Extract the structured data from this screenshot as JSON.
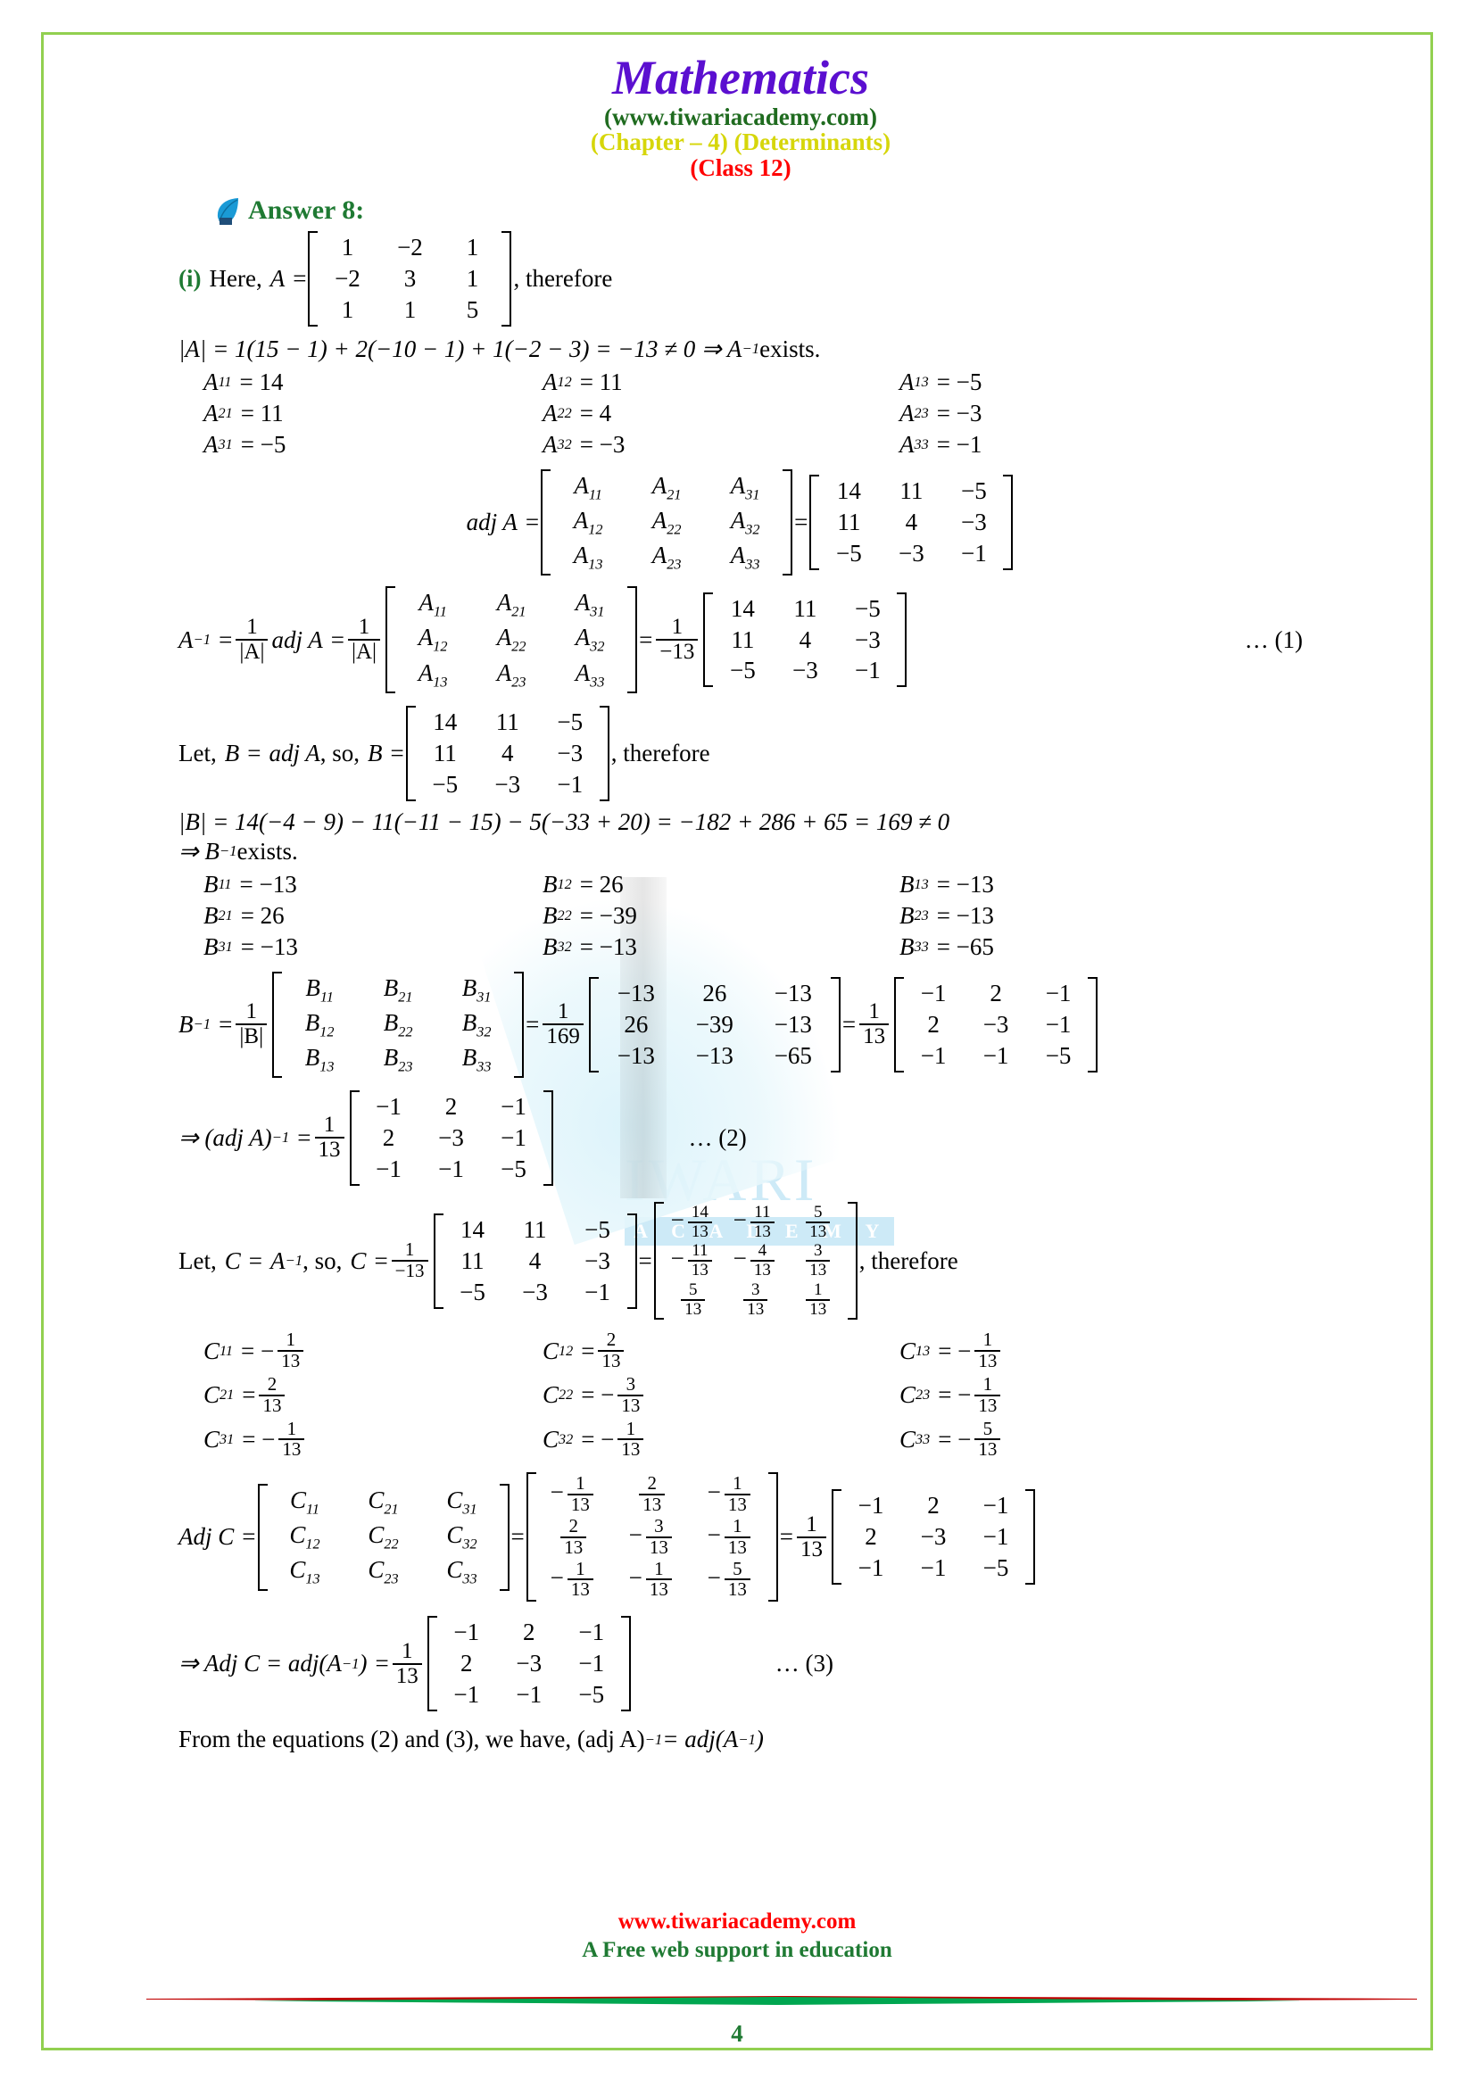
{
  "header": {
    "title": "Mathematics",
    "site": "(www.tiwariacademy.com)",
    "chapter": "(Chapter – 4) (Determinants)",
    "klass": "(Class 12)"
  },
  "answer": {
    "label": "Answer",
    "number": "8",
    "colon": ":",
    "icon": "leaf-icon"
  },
  "part_i": {
    "marker": "(i)",
    "here": "Here,",
    "A": "A",
    "eq": "=",
    "therefore": ", therefore",
    "matrix_A": [
      [
        "1",
        "−2",
        "1"
      ],
      [
        "−2",
        "3",
        "1"
      ],
      [
        "1",
        "1",
        "5"
      ]
    ]
  },
  "detA": {
    "text": "|A| = 1(15 − 1) + 2(−10 − 1) + 1(−2 − 3) = −13 ≠ 0  ⇒  A",
    "sup": "−1",
    "tail": " exists."
  },
  "A_cofactors": [
    [
      {
        "sym": "A",
        "sub": "11",
        "val": "= 14"
      },
      {
        "sym": "A",
        "sub": "12",
        "val": "= 11"
      },
      {
        "sym": "A",
        "sub": "13",
        "val": "= −5"
      }
    ],
    [
      {
        "sym": "A",
        "sub": "21",
        "val": "= 11"
      },
      {
        "sym": "A",
        "sub": "22",
        "val": "= 4"
      },
      {
        "sym": "A",
        "sub": "23",
        "val": "= −3"
      }
    ],
    [
      {
        "sym": "A",
        "sub": "31",
        "val": "= −5"
      },
      {
        "sym": "A",
        "sub": "32",
        "val": "= −3"
      },
      {
        "sym": "A",
        "sub": "33",
        "val": "= −1"
      }
    ]
  ],
  "adjA": {
    "label": "adj A",
    "eq1": "=",
    "eq2": "=",
    "sym_matrix": [
      [
        "A11",
        "A21",
        "A31"
      ],
      [
        "A12",
        "A22",
        "A32"
      ],
      [
        "A13",
        "A23",
        "A33"
      ]
    ],
    "num_matrix": [
      [
        "14",
        "11",
        "−5"
      ],
      [
        "11",
        "4",
        "−3"
      ],
      [
        "−5",
        "−3",
        "−1"
      ]
    ]
  },
  "Ainv": {
    "lhs": "A",
    "lhs_sup": "−1",
    "eq": "=",
    "frac_num": "1",
    "frac_den": "|A|",
    "adjtext": "adj A",
    "eq2": "=",
    "frac2_num": "1",
    "frac2_den": "|A|",
    "sym_matrix": [
      [
        "A11",
        "A21",
        "A31"
      ],
      [
        "A12",
        "A22",
        "A32"
      ],
      [
        "A13",
        "A23",
        "A33"
      ]
    ],
    "eq3": "=",
    "frac3_num": "1",
    "frac3_den": "−13",
    "num_matrix": [
      [
        "14",
        "11",
        "−5"
      ],
      [
        "11",
        "4",
        "−3"
      ],
      [
        "−5",
        "−3",
        "−1"
      ]
    ],
    "ref": "… (1)"
  },
  "letB": {
    "pre": "Let,",
    "B": "B",
    "eq1": "=",
    "adjA": "adj A",
    "so": ", so,",
    "B2": "B",
    "eq2": "=",
    "matrix": [
      [
        "14",
        "11",
        "−5"
      ],
      [
        "11",
        "4",
        "−3"
      ],
      [
        "−5",
        "−3",
        "−1"
      ]
    ],
    "post": ", therefore"
  },
  "detB": {
    "line1": "|B| = 14(−4 − 9) − 11(−11 − 15) − 5(−33 + 20) = −182 + 286 + 65 = 169 ≠ 0",
    "line2_pre": "⇒  B",
    "line2_sup": "−1",
    "line2_post": " exists."
  },
  "B_cofactors": [
    [
      {
        "sym": "B",
        "sub": "11",
        "val": "= −13"
      },
      {
        "sym": "B",
        "sub": "12",
        "val": "= 26"
      },
      {
        "sym": "B",
        "sub": "13",
        "val": "= −13"
      }
    ],
    [
      {
        "sym": "B",
        "sub": "21",
        "val": "= 26"
      },
      {
        "sym": "B",
        "sub": "22",
        "val": "= −39"
      },
      {
        "sym": "B",
        "sub": "23",
        "val": "= −13"
      }
    ],
    [
      {
        "sym": "B",
        "sub": "31",
        "val": "= −13"
      },
      {
        "sym": "B",
        "sub": "32",
        "val": "= −13"
      },
      {
        "sym": "B",
        "sub": "33",
        "val": "= −65"
      }
    ]
  ],
  "Binv": {
    "lhs": "B",
    "lhs_sup": "−1",
    "eq": "=",
    "frac_num": "1",
    "frac_den": "|B|",
    "sym_matrix": [
      [
        "B11",
        "B21",
        "B31"
      ],
      [
        "B12",
        "B22",
        "B32"
      ],
      [
        "B13",
        "B23",
        "B33"
      ]
    ],
    "eq2": "=",
    "frac2_num": "1",
    "frac2_den": "169",
    "num_matrix": [
      [
        "−13",
        "26",
        "−13"
      ],
      [
        "26",
        "−39",
        "−13"
      ],
      [
        "−13",
        "−13",
        "−65"
      ]
    ],
    "eq3": "=",
    "frac3_num": "1",
    "frac3_den": "13",
    "final_matrix": [
      [
        "−1",
        "2",
        "−1"
      ],
      [
        "2",
        "−3",
        "−1"
      ],
      [
        "−1",
        "−1",
        "−5"
      ]
    ]
  },
  "adjAinv": {
    "pre": "⇒ (adj A)",
    "sup": "−1",
    "eq": "=",
    "frac_num": "1",
    "frac_den": "13",
    "matrix": [
      [
        "−1",
        "2",
        "−1"
      ],
      [
        "2",
        "−3",
        "−1"
      ],
      [
        "−1",
        "−1",
        "−5"
      ]
    ],
    "ref": "… (2)"
  },
  "letC": {
    "pre": "Let,",
    "C": "C",
    "eq1": "=",
    "Ainv": "A",
    "Ainv_sup": "−1",
    "so": ", so,",
    "C2": "C",
    "eq2": "=",
    "frac_num": "1",
    "frac_den": "−13",
    "matrix": [
      [
        "14",
        "11",
        "−5"
      ],
      [
        "11",
        "4",
        "−3"
      ],
      [
        "−5",
        "−3",
        "−1"
      ]
    ],
    "eq3": "=",
    "frac_matrix": [
      [
        {
          "sign": "−",
          "n": "14",
          "d": "13"
        },
        {
          "sign": "−",
          "n": "11",
          "d": "13"
        },
        {
          "sign": "",
          "n": "5",
          "d": "13"
        }
      ],
      [
        {
          "sign": "−",
          "n": "11",
          "d": "13"
        },
        {
          "sign": "−",
          "n": "4",
          "d": "13"
        },
        {
          "sign": "",
          "n": "3",
          "d": "13"
        }
      ],
      [
        {
          "sign": "",
          "n": "5",
          "d": "13"
        },
        {
          "sign": "",
          "n": "3",
          "d": "13"
        },
        {
          "sign": "",
          "n": "1",
          "d": "13"
        }
      ]
    ],
    "post": ", therefore"
  },
  "C_cofactors": [
    [
      {
        "sym": "C",
        "sub": "11",
        "sign": "= −",
        "n": "1",
        "d": "13"
      },
      {
        "sym": "C",
        "sub": "12",
        "sign": "= ",
        "n": "2",
        "d": "13"
      },
      {
        "sym": "C",
        "sub": "13",
        "sign": "= −",
        "n": "1",
        "d": "13"
      }
    ],
    [
      {
        "sym": "C",
        "sub": "21",
        "sign": "= ",
        "n": "2",
        "d": "13"
      },
      {
        "sym": "C",
        "sub": "22",
        "sign": "= −",
        "n": "3",
        "d": "13"
      },
      {
        "sym": "C",
        "sub": "23",
        "sign": "= −",
        "n": "1",
        "d": "13"
      }
    ],
    [
      {
        "sym": "C",
        "sub": "31",
        "sign": "= −",
        "n": "1",
        "d": "13"
      },
      {
        "sym": "C",
        "sub": "32",
        "sign": "= −",
        "n": "1",
        "d": "13"
      },
      {
        "sym": "C",
        "sub": "33",
        "sign": "= −",
        "n": "5",
        "d": "13"
      }
    ]
  ],
  "adjC": {
    "label": "Adj C",
    "eq1": "=",
    "sym_matrix": [
      [
        "C11",
        "C21",
        "C31"
      ],
      [
        "C12",
        "C22",
        "C32"
      ],
      [
        "C13",
        "C23",
        "C33"
      ]
    ],
    "eq2": "=",
    "frac_matrix": [
      [
        {
          "sign": "−",
          "n": "1",
          "d": "13"
        },
        {
          "sign": "",
          "n": "2",
          "d": "13"
        },
        {
          "sign": "−",
          "n": "1",
          "d": "13"
        }
      ],
      [
        {
          "sign": "",
          "n": "2",
          "d": "13"
        },
        {
          "sign": "−",
          "n": "3",
          "d": "13"
        },
        {
          "sign": "−",
          "n": "1",
          "d": "13"
        }
      ],
      [
        {
          "sign": "−",
          "n": "1",
          "d": "13"
        },
        {
          "sign": "−",
          "n": "1",
          "d": "13"
        },
        {
          "sign": "−",
          "n": "5",
          "d": "13"
        }
      ]
    ],
    "eq3": "=",
    "frac_num": "1",
    "frac_den": "13",
    "final_matrix": [
      [
        "−1",
        "2",
        "−1"
      ],
      [
        "2",
        "−3",
        "−1"
      ],
      [
        "−1",
        "−1",
        "−5"
      ]
    ]
  },
  "adjCfinal": {
    "pre": "⇒ Adj C = adj(A",
    "sup": "−1",
    "post": ")",
    "eq": "=",
    "frac_num": "1",
    "frac_den": "13",
    "matrix": [
      [
        "−1",
        "2",
        "−1"
      ],
      [
        "2",
        "−3",
        "−1"
      ],
      [
        "−1",
        "−1",
        "−5"
      ]
    ],
    "ref": "… (3)"
  },
  "conclusion": {
    "text": "From the equations (2) and (3), we have, (adj A)",
    "sup1": "−1",
    "mid": " = adj(A",
    "sup2": "−1",
    "end": ")"
  },
  "watermark": {
    "main": "IWARI",
    "sub": "A C A D E M Y"
  },
  "footer": {
    "site": "www.tiwariacademy.com",
    "tagline": "A Free web support in education",
    "page": "4"
  }
}
